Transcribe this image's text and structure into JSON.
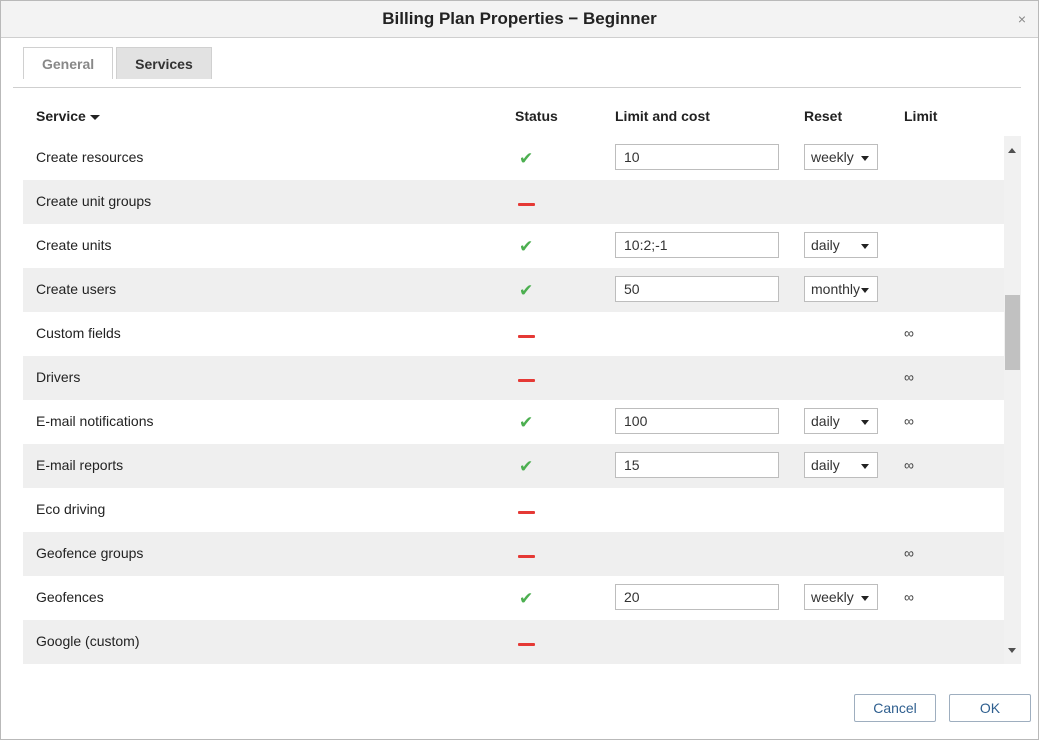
{
  "dialog": {
    "title": "Billing Plan Properties − Beginner",
    "close_label": "×"
  },
  "tabs": [
    {
      "label": "General",
      "active": false
    },
    {
      "label": "Services",
      "active": true
    }
  ],
  "table": {
    "columns": {
      "service": "Service",
      "status": "Status",
      "limit_cost": "Limit and cost",
      "reset": "Reset",
      "limit": "Limit"
    },
    "rows": [
      {
        "name": "Create resources",
        "status": "enabled",
        "limit_value": "10",
        "reset": "weekly",
        "limit": ""
      },
      {
        "name": "Create unit groups",
        "status": "disabled",
        "limit_value": null,
        "reset": null,
        "limit": ""
      },
      {
        "name": "Create units",
        "status": "enabled",
        "limit_value": "10:2;-1",
        "reset": "daily",
        "limit": ""
      },
      {
        "name": "Create users",
        "status": "enabled",
        "limit_value": "50",
        "reset": "monthly",
        "limit": ""
      },
      {
        "name": "Custom fields",
        "status": "disabled",
        "limit_value": null,
        "reset": null,
        "limit": "∞"
      },
      {
        "name": "Drivers",
        "status": "disabled",
        "limit_value": null,
        "reset": null,
        "limit": "∞"
      },
      {
        "name": "E-mail notifications",
        "status": "enabled",
        "limit_value": "100",
        "reset": "daily",
        "limit": "∞"
      },
      {
        "name": "E-mail reports",
        "status": "enabled",
        "limit_value": "15",
        "reset": "daily",
        "limit": "∞"
      },
      {
        "name": "Eco driving",
        "status": "disabled",
        "limit_value": null,
        "reset": null,
        "limit": ""
      },
      {
        "name": "Geofence groups",
        "status": "disabled",
        "limit_value": null,
        "reset": null,
        "limit": "∞"
      },
      {
        "name": "Geofences",
        "status": "enabled",
        "limit_value": "20",
        "reset": "weekly",
        "limit": "∞"
      },
      {
        "name": "Google (custom)",
        "status": "disabled",
        "limit_value": null,
        "reset": null,
        "limit": ""
      }
    ]
  },
  "buttons": {
    "cancel": "Cancel",
    "ok": "OK"
  },
  "colors": {
    "enabled_check": "#4caf50",
    "disabled_dash": "#e53935",
    "row_alt": "#efefef",
    "button_text": "#2f5f8f"
  },
  "icons": {
    "enabled": "check-icon",
    "disabled": "dash-icon",
    "sort": "sort-caret-icon",
    "scroll_up": "arrow-up-icon",
    "scroll_down": "arrow-down-icon"
  }
}
